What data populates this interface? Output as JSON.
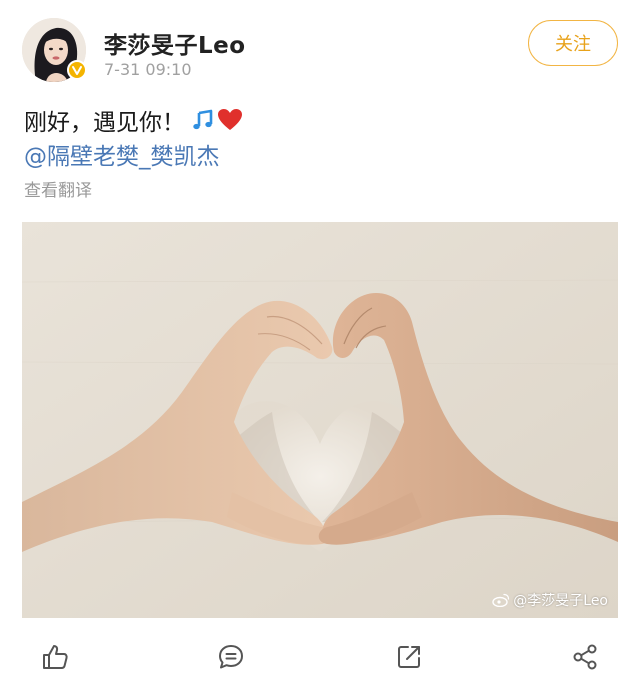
{
  "post": {
    "user": {
      "name": "李莎旻子Leo",
      "verified": true,
      "avatar_icon": "user-avatar"
    },
    "timestamp": "7-31 09:10",
    "follow_label": "关注",
    "text": "刚好，遇见你！",
    "emojis": [
      "music-note-icon",
      "red-heart-icon"
    ],
    "mention": "@隔壁老樊_樊凯杰",
    "translate_label": "查看翻译",
    "image": {
      "description_icon": "heart-hands-photo",
      "watermark": "@李莎旻子Leo"
    },
    "actions": [
      "like-icon",
      "comment-icon",
      "repost-icon",
      "share-icon"
    ]
  },
  "colors": {
    "accent": "#e8a21a",
    "follow_border": "#f2b544",
    "mention": "#4a78b5",
    "muted": "#999999",
    "verified_badge": "#f4b400",
    "heart": "#e0302c",
    "music_note": "#2f8fe0"
  }
}
